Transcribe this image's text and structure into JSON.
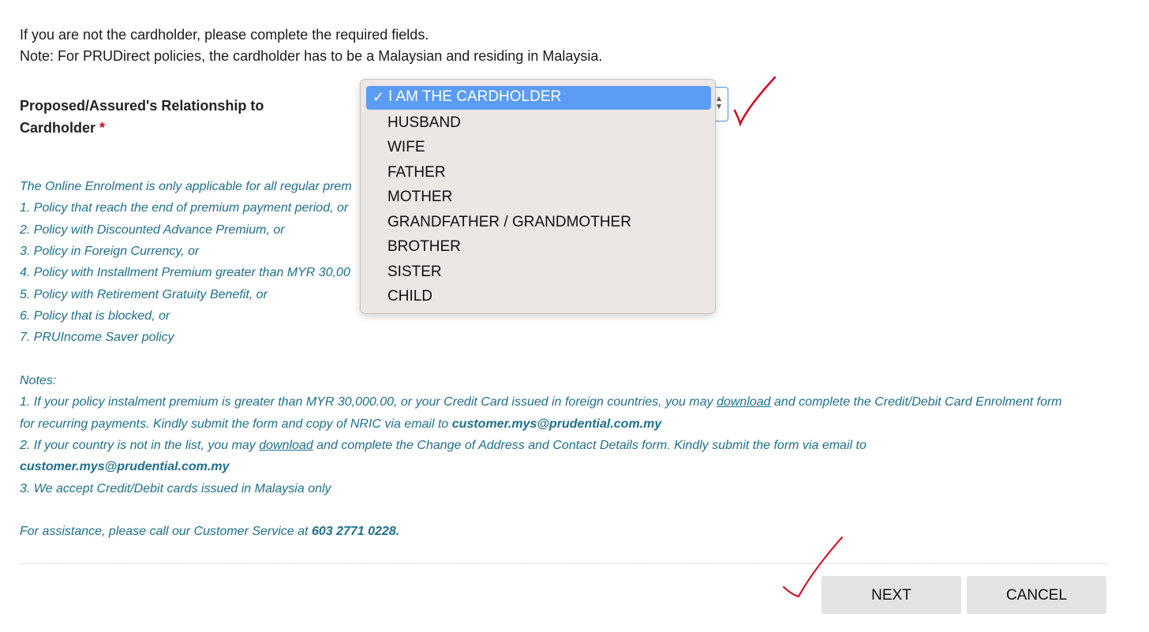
{
  "intro": {
    "line1": "If you are not the cardholder, please complete the required fields.",
    "line2": "Note: For PRUDirect policies, the cardholder has to be a Malaysian and residing in Malaysia."
  },
  "relationship": {
    "label_line1": "Proposed/Assured's Relationship to",
    "label_line2": "Cardholder",
    "required_mark": "*",
    "selected": "I AM THE CARDHOLDER",
    "options": [
      "I AM THE CARDHOLDER",
      "HUSBAND",
      "WIFE",
      "FATHER",
      "MOTHER",
      "GRANDFATHER / GRANDMOTHER",
      "BROTHER",
      "SISTER",
      "CHILD"
    ]
  },
  "info": {
    "line0": "The Online Enrolment is only applicable for all regular prem",
    "items": [
      "1. Policy that reach the end of premium payment period, or",
      "2. Policy with Discounted Advance Premium, or",
      "3. Policy in Foreign Currency, or",
      "4. Policy with Installment Premium greater than MYR 30,00",
      "5. Policy with Retirement Gratuity Benefit, or",
      "6. Policy that is blocked, or",
      "7. PRUIncome Saver policy"
    ],
    "notes_heading": "Notes:",
    "note1_a": "1. If your policy instalment premium is greater than MYR 30,000.00, or your Credit Card issued in foreign countries, you may ",
    "note1_link": "download",
    "note1_b": " and complete the Credit/Debit Card Enrolment form",
    "note1_c": "for recurring payments. Kindly submit the form and copy of NRIC via email to ",
    "email": "customer.mys@prudential.com.my",
    "note2_a": "2. If your country is not in the list, you may ",
    "note2_link": "download",
    "note2_b": " and complete the Change of Address and Contact Details form. Kindly submit the form via email to",
    "note3": "3. We accept Credit/Debit cards issued in Malaysia only",
    "assist_a": "For assistance, please call our Customer Service at ",
    "assist_phone": "603 2771 0228."
  },
  "buttons": {
    "next": "NEXT",
    "cancel": "CANCEL"
  },
  "colors": {
    "info_text": "#1f6f8b",
    "selected_option_bg": "#5b9cf5",
    "annotation_red": "#d0021b"
  }
}
